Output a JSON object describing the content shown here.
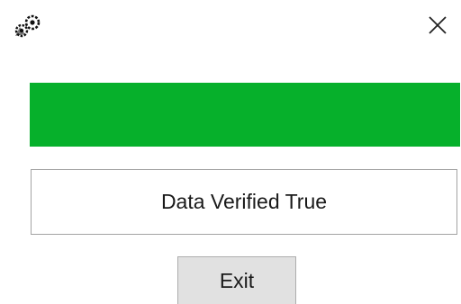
{
  "titlebar": {
    "app_icon": "gears-icon",
    "close_icon": "close-icon"
  },
  "progress": {
    "value": 1.0,
    "color": "#06b02b"
  },
  "status": {
    "text": "Data Verified True"
  },
  "actions": {
    "exit_label": "Exit"
  }
}
